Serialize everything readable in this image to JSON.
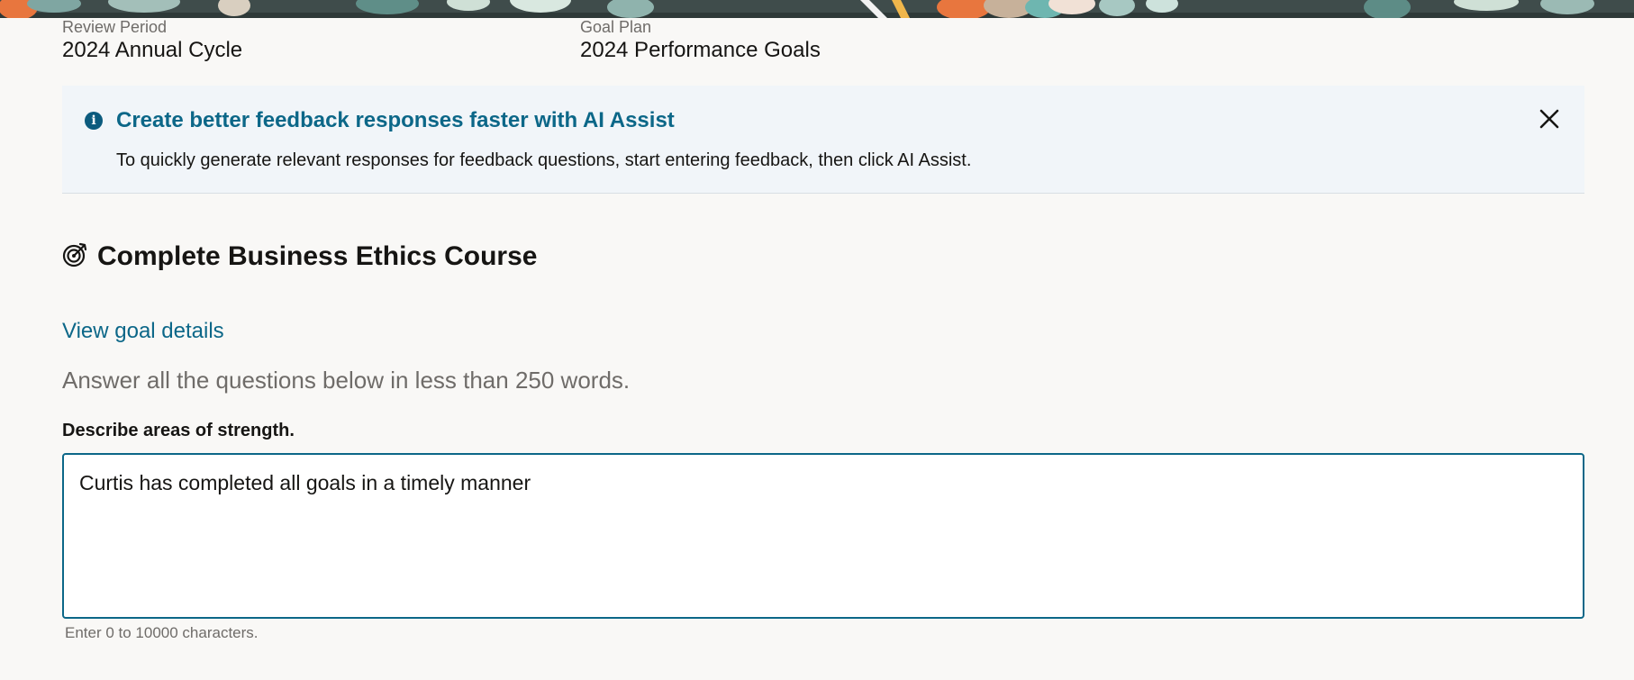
{
  "header": {
    "review_period": {
      "label": "Review Period",
      "value": "2024 Annual Cycle"
    },
    "goal_plan": {
      "label": "Goal Plan",
      "value": "2024 Performance Goals"
    }
  },
  "ai_assist_banner": {
    "icon": "info-icon",
    "title": "Create better feedback responses faster with AI Assist",
    "message": "To quickly generate relevant responses for feedback questions, start entering feedback, then click AI Assist.",
    "close_icon": "close-icon"
  },
  "goal": {
    "icon": "target-icon",
    "title": "Complete Business Ethics Course",
    "details_link": "View goal details"
  },
  "questions": {
    "instructions": "Answer all the questions below in less than 250 words.",
    "items": [
      {
        "label": "Describe areas of strength.",
        "answer": "Curtis has completed all goals in a timely manner",
        "helper": "Enter 0 to 10000 characters."
      }
    ]
  },
  "colors": {
    "accent": "#0c6788",
    "info_background": "#f1f5f9",
    "page_background": "#f9f8f6",
    "muted_text": "#6f6c69"
  }
}
